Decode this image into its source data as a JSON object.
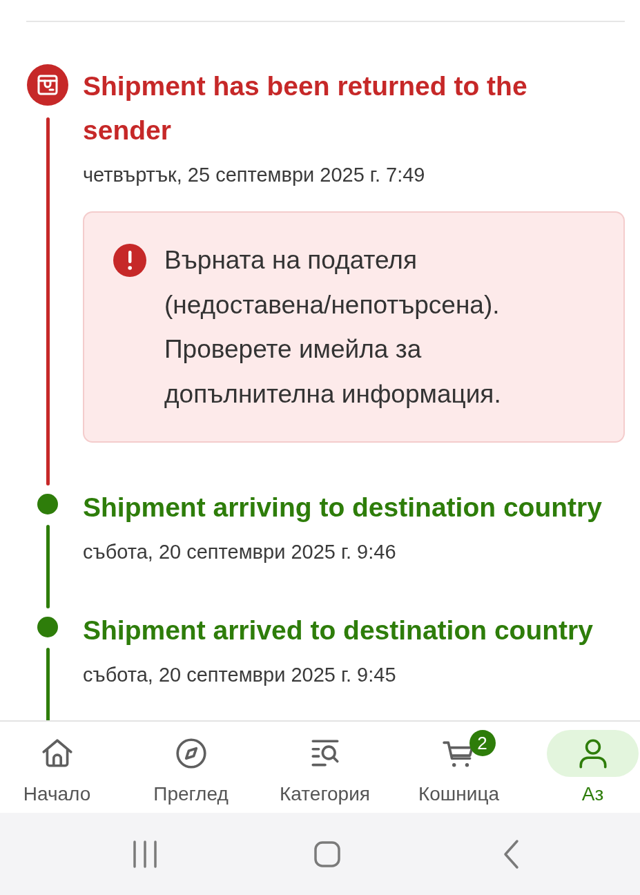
{
  "events": [
    {
      "kind": "returned",
      "title": "Shipment has been returned to the sender",
      "date": "четвъртък, 25 септември 2025 г. 7:49",
      "note": "Върната на подателя (недоставена/непотърсена). Проверете имейла за допълнителна информация."
    },
    {
      "kind": "transit",
      "title": "Shipment arriving to destination country",
      "date": "събота, 20 септември 2025 г. 9:46"
    },
    {
      "kind": "transit",
      "title": "Shipment arrived to destination country",
      "date": "събота, 20 септември 2025 г. 9:45"
    }
  ],
  "bottom_nav": [
    {
      "kind": "home",
      "label": "Начало",
      "selected": false
    },
    {
      "kind": "explore",
      "label": "Преглед",
      "selected": false
    },
    {
      "kind": "categories",
      "label": "Категория",
      "selected": false
    },
    {
      "kind": "cart",
      "label": "Кошница",
      "selected": false,
      "badge": "2"
    },
    {
      "kind": "profile",
      "label": "Аз",
      "selected": true
    }
  ]
}
